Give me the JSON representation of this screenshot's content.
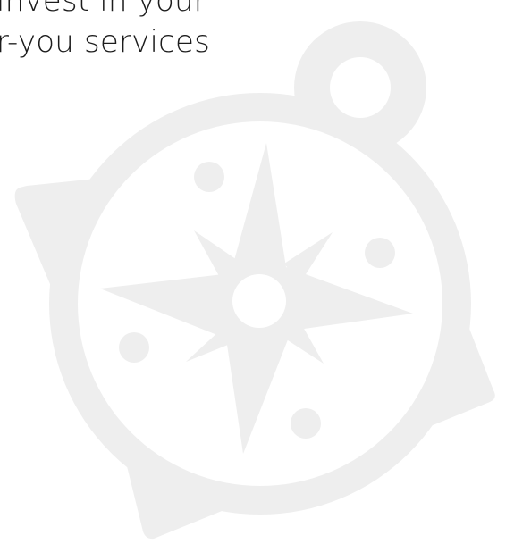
{
  "headline": {
    "line1": "invest in your",
    "line2": "r-you services"
  },
  "illustration": {
    "icon": "compass-icon",
    "color": "#eeeeee"
  }
}
